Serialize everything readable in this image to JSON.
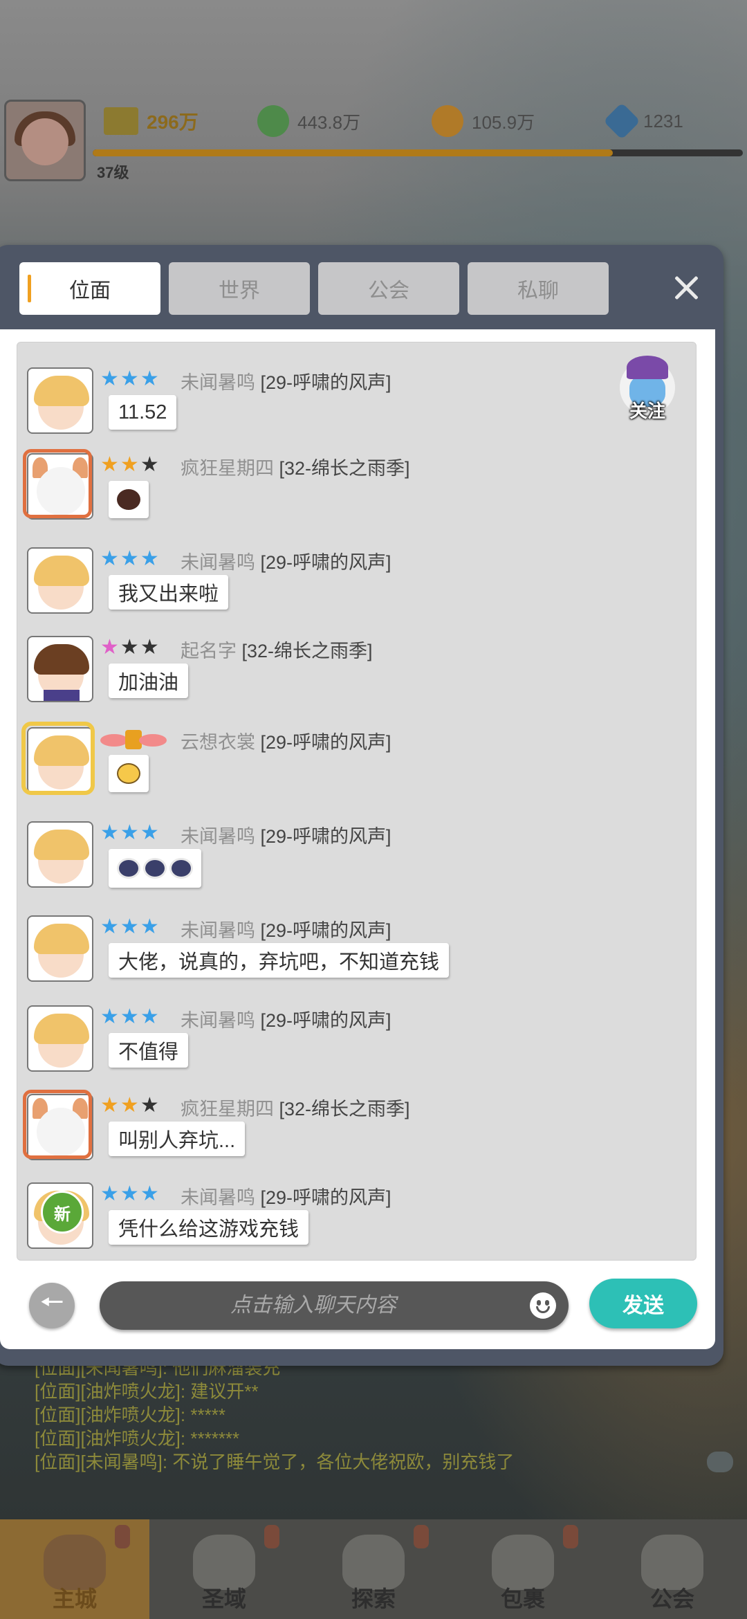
{
  "top_bar": {
    "power": "296万",
    "gold": "443.8万",
    "coin": "105.9万",
    "gem": "1231",
    "level": "37级",
    "level_progress": 0.8
  },
  "tabs": [
    {
      "label": "位面",
      "active": true
    },
    {
      "label": "世界",
      "active": false
    },
    {
      "label": "公会",
      "active": false
    },
    {
      "label": "私聊",
      "active": false
    }
  ],
  "follow_label": "关注",
  "messages": [
    {
      "name": "未闻暑鸣",
      "guild": "[29-呼啸的风声]",
      "text": "11.52"
    },
    {
      "name": "疯狂星期四",
      "guild": "[32-绵长之雨季]",
      "emoji": "dark-blob-emoji"
    },
    {
      "name": "未闻暑鸣",
      "guild": "[29-呼啸的风声]",
      "text": "我又出来啦"
    },
    {
      "name": "起名字",
      "guild": "[32-绵长之雨季]",
      "text": "加油油"
    },
    {
      "name": "云想衣裳",
      "guild": "[29-呼啸的风声]",
      "emoji": "duck-emoji"
    },
    {
      "name": "未闻暑鸣",
      "guild": "[29-呼啸的风声]",
      "emoji": "police-emoji-x3"
    },
    {
      "name": "未闻暑鸣",
      "guild": "[29-呼啸的风声]",
      "text": "大佬，说真的，弃坑吧，不知道充钱"
    },
    {
      "name": "未闻暑鸣",
      "guild": "[29-呼啸的风声]",
      "text": "不值得"
    },
    {
      "name": "疯狂星期四",
      "guild": "[32-绵长之雨季]",
      "text": "叫别人弃坑..."
    },
    {
      "name": "未闻暑鸣",
      "guild": "[29-呼啸的风声]",
      "text": "凭什么给这游戏充钱",
      "new_badge": "新"
    }
  ],
  "input": {
    "placeholder": "点击输入聊天内容",
    "send_label": "发送"
  },
  "background_log": [
    "[位面][未闻暑鸣]: 他们麻溜装充",
    "[位面][油炸喷火龙]: 建议开**",
    "[位面][油炸喷火龙]: *****",
    "[位面][油炸喷火龙]: *******",
    "[位面][未闻暑鸣]: 不说了睡午觉了，各位大佬祝欧，别充钱了"
  ],
  "bottom_nav": [
    {
      "label": "主城",
      "active": true
    },
    {
      "label": "圣域",
      "active": false
    },
    {
      "label": "探索",
      "active": false
    },
    {
      "label": "包裹",
      "active": false
    },
    {
      "label": "公会",
      "active": false
    }
  ],
  "colors": {
    "accent_tab": "#f0a020",
    "send": "#2dc0b6",
    "panel": "#4e5666"
  }
}
